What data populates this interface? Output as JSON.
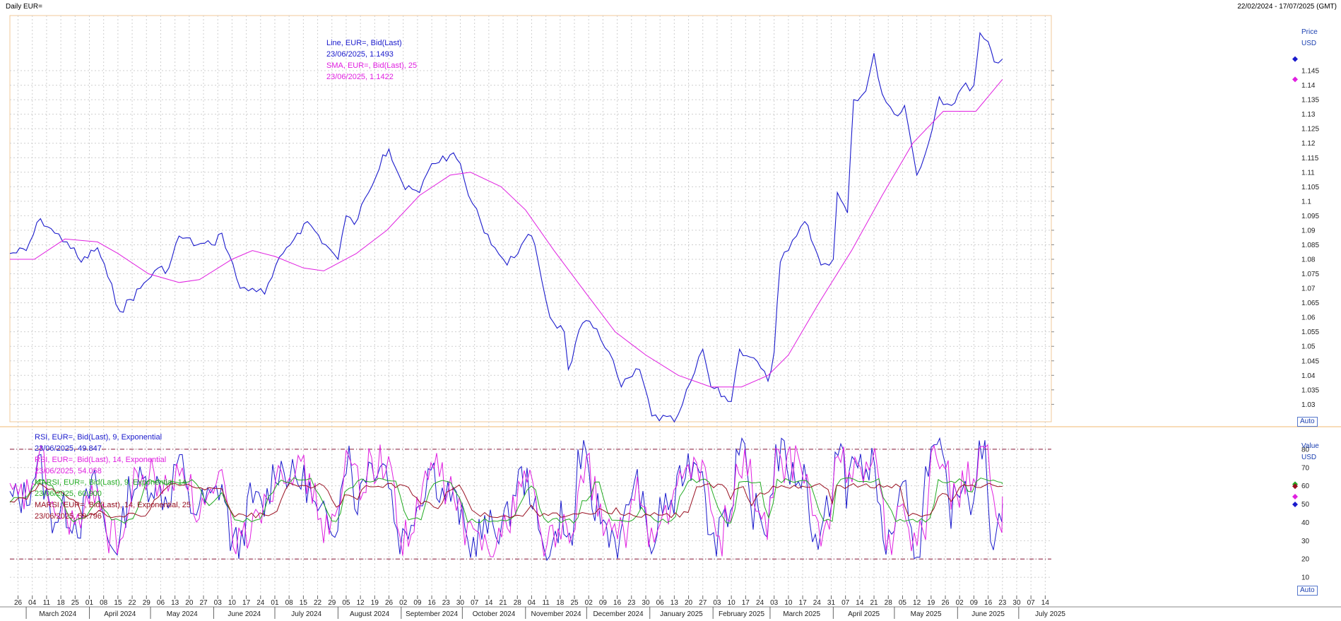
{
  "header": {
    "title": "Daily EUR=",
    "range": "22/02/2024 - 17/07/2025 (GMT)"
  },
  "price_panel": {
    "axis_title": "Price",
    "axis_unit": "USD",
    "auto_label": "Auto",
    "legend": [
      {
        "text": "Line, EUR=, Bid(Last)",
        "color": "#1a1acc"
      },
      {
        "text": "23/06/2025, 1.1493",
        "color": "#1a1acc"
      },
      {
        "text": "SMA, EUR=, Bid(Last),  25",
        "color": "#e020e0"
      },
      {
        "text": "23/06/2025, 1.1422",
        "color": "#e020e0"
      }
    ]
  },
  "rsi_panel": {
    "axis_title": "Value",
    "axis_unit": "USD",
    "auto_label": "Auto",
    "legend": [
      {
        "text": "RSI, EUR=, Bid(Last),  9, Exponential",
        "color": "#1a1acc"
      },
      {
        "text": "23/06/2025, 49.847",
        "color": "#1a1acc"
      },
      {
        "text": "RSI, EUR=, Bid(Last),  14, Exponential",
        "color": "#e020e0"
      },
      {
        "text": "23/06/2025, 54.058",
        "color": "#e020e0"
      },
      {
        "text": "MARSI, EUR=, Bid(Last),  9, Exponential, 14",
        "color": "#22aa22"
      },
      {
        "text": "23/06/2025, 60.900",
        "color": "#22aa22"
      },
      {
        "text": "MARSI, EUR=, Bid(Last),  14, Exponential, 25",
        "color": "#991122"
      },
      {
        "text": "23/06/2025, 59.796",
        "color": "#991122"
      }
    ]
  },
  "x_axis": {
    "day_ticks": [
      "26",
      "04",
      "11",
      "18",
      "25",
      "01",
      "08",
      "15",
      "22",
      "29",
      "06",
      "13",
      "20",
      "27",
      "03",
      "10",
      "17",
      "24",
      "01",
      "08",
      "15",
      "22",
      "29",
      "05",
      "12",
      "19",
      "26",
      "02",
      "09",
      "16",
      "23",
      "30",
      "07",
      "14",
      "21",
      "28",
      "04",
      "11",
      "18",
      "25",
      "02",
      "09",
      "16",
      "23",
      "30",
      "06",
      "13",
      "20",
      "27",
      "03",
      "10",
      "17",
      "24",
      "03",
      "10",
      "17",
      "24",
      "31",
      "07",
      "14",
      "21",
      "28",
      "05",
      "12",
      "19",
      "26",
      "02",
      "09",
      "16",
      "23",
      "30",
      "07",
      "14"
    ],
    "months": [
      "March 2024",
      "April 2024",
      "May 2024",
      "June 2024",
      "July 2024",
      "August 2024",
      "September 2024",
      "October 2024",
      "November 2024",
      "December 2024",
      "January 2025",
      "February 2025",
      "March 2025",
      "April 2025",
      "May 2025",
      "June 2025",
      "July 2025"
    ]
  },
  "chart_data": [
    {
      "type": "line",
      "title": "Daily EUR=",
      "ylabel": "Price USD",
      "ylim": [
        1.024,
        1.164
      ],
      "yticks": [
        "1.03",
        "1.035",
        "1.04",
        "1.045",
        "1.05",
        "1.055",
        "1.06",
        "1.065",
        "1.07",
        "1.075",
        "1.08",
        "1.085",
        "1.09",
        "1.095",
        "1.1",
        "1.105",
        "1.11",
        "1.115",
        "1.12",
        "1.125",
        "1.13",
        "1.135",
        "1.14",
        "1.145"
      ],
      "x_start": "2024-02-22",
      "x_end": "2025-07-17",
      "series": [
        {
          "name": "Line, EUR=, Bid(Last)",
          "color": "#1a1acc",
          "points": [
            [
              "2024-02-22",
              1.082
            ],
            [
              "2024-03-01",
              1.083
            ],
            [
              "2024-03-08",
              1.094
            ],
            [
              "2024-03-15",
              1.089
            ],
            [
              "2024-03-21",
              1.086
            ],
            [
              "2024-03-28",
              1.079
            ],
            [
              "2024-04-05",
              1.084
            ],
            [
              "2024-04-10",
              1.074
            ],
            [
              "2024-04-16",
              1.062
            ],
            [
              "2024-04-26",
              1.07
            ],
            [
              "2024-05-03",
              1.076
            ],
            [
              "2024-05-10",
              1.077
            ],
            [
              "2024-05-15",
              1.088
            ],
            [
              "2024-05-24",
              1.085
            ],
            [
              "2024-05-31",
              1.085
            ],
            [
              "2024-06-05",
              1.089
            ],
            [
              "2024-06-14",
              1.07
            ],
            [
              "2024-06-20",
              1.07
            ],
            [
              "2024-06-26",
              1.068
            ],
            [
              "2024-07-05",
              1.082
            ],
            [
              "2024-07-12",
              1.089
            ],
            [
              "2024-07-17",
              1.093
            ],
            [
              "2024-07-26",
              1.085
            ],
            [
              "2024-08-01",
              1.08
            ],
            [
              "2024-08-05",
              1.095
            ],
            [
              "2024-08-09",
              1.092
            ],
            [
              "2024-08-16",
              1.103
            ],
            [
              "2024-08-23",
              1.116
            ],
            [
              "2024-08-26",
              1.118
            ],
            [
              "2024-09-03",
              1.104
            ],
            [
              "2024-09-10",
              1.103
            ],
            [
              "2024-09-16",
              1.113
            ],
            [
              "2024-09-25",
              1.116
            ],
            [
              "2024-09-30",
              1.113
            ],
            [
              "2024-10-04",
              1.102
            ],
            [
              "2024-10-10",
              1.093
            ],
            [
              "2024-10-17",
              1.084
            ],
            [
              "2024-10-23",
              1.078
            ],
            [
              "2024-10-30",
              1.085
            ],
            [
              "2024-11-04",
              1.088
            ],
            [
              "2024-11-07",
              1.08
            ],
            [
              "2024-11-13",
              1.06
            ],
            [
              "2024-11-20",
              1.055
            ],
            [
              "2024-11-22",
              1.042
            ],
            [
              "2024-11-29",
              1.058
            ],
            [
              "2024-12-06",
              1.056
            ],
            [
              "2024-12-12",
              1.048
            ],
            [
              "2024-12-18",
              1.036
            ],
            [
              "2024-12-27",
              1.042
            ],
            [
              "2025-01-02",
              1.026
            ],
            [
              "2025-01-13",
              1.024
            ],
            [
              "2025-01-17",
              1.03
            ],
            [
              "2025-01-23",
              1.041
            ],
            [
              "2025-01-27",
              1.049
            ],
            [
              "2025-01-31",
              1.036
            ],
            [
              "2025-02-10",
              1.031
            ],
            [
              "2025-02-14",
              1.049
            ],
            [
              "2025-02-21",
              1.046
            ],
            [
              "2025-02-28",
              1.038
            ],
            [
              "2025-03-03",
              1.048
            ],
            [
              "2025-03-06",
              1.079
            ],
            [
              "2025-03-10",
              1.083
            ],
            [
              "2025-03-14",
              1.088
            ],
            [
              "2025-03-18",
              1.093
            ],
            [
              "2025-03-26",
              1.078
            ],
            [
              "2025-04-01",
              1.08
            ],
            [
              "2025-04-03",
              1.103
            ],
            [
              "2025-04-08",
              1.096
            ],
            [
              "2025-04-11",
              1.135
            ],
            [
              "2025-04-17",
              1.138
            ],
            [
              "2025-04-21",
              1.151
            ],
            [
              "2025-04-25",
              1.137
            ],
            [
              "2025-05-01",
              1.13
            ],
            [
              "2025-05-06",
              1.133
            ],
            [
              "2025-05-12",
              1.109
            ],
            [
              "2025-05-16",
              1.116
            ],
            [
              "2025-05-23",
              1.136
            ],
            [
              "2025-05-29",
              1.133
            ],
            [
              "2025-06-03",
              1.139
            ],
            [
              "2025-06-09",
              1.14
            ],
            [
              "2025-06-12",
              1.158
            ],
            [
              "2025-06-16",
              1.155
            ],
            [
              "2025-06-19",
              1.148
            ],
            [
              "2025-06-23",
              1.149
            ]
          ]
        },
        {
          "name": "SMA, EUR=, Bid(Last),  25",
          "color": "#e020e0",
          "points": [
            [
              "2024-02-22",
              1.08
            ],
            [
              "2024-03-05",
              1.08
            ],
            [
              "2024-03-20",
              1.087
            ],
            [
              "2024-04-05",
              1.086
            ],
            [
              "2024-04-15",
              1.082
            ],
            [
              "2024-04-30",
              1.075
            ],
            [
              "2024-05-15",
              1.072
            ],
            [
              "2024-05-25",
              1.073
            ],
            [
              "2024-06-10",
              1.08
            ],
            [
              "2024-06-20",
              1.083
            ],
            [
              "2024-07-01",
              1.081
            ],
            [
              "2024-07-15",
              1.077
            ],
            [
              "2024-07-25",
              1.076
            ],
            [
              "2024-08-10",
              1.082
            ],
            [
              "2024-08-25",
              1.09
            ],
            [
              "2024-09-10",
              1.102
            ],
            [
              "2024-09-25",
              1.109
            ],
            [
              "2024-10-05",
              1.11
            ],
            [
              "2024-10-20",
              1.105
            ],
            [
              "2024-11-01",
              1.097
            ],
            [
              "2024-11-15",
              1.083
            ],
            [
              "2024-12-01",
              1.068
            ],
            [
              "2024-12-15",
              1.055
            ],
            [
              "2024-12-30",
              1.047
            ],
            [
              "2025-01-15",
              1.04
            ],
            [
              "2025-01-31",
              1.036
            ],
            [
              "2025-02-15",
              1.036
            ],
            [
              "2025-02-28",
              1.04
            ],
            [
              "2025-03-10",
              1.047
            ],
            [
              "2025-03-25",
              1.065
            ],
            [
              "2025-04-10",
              1.083
            ],
            [
              "2025-04-25",
              1.102
            ],
            [
              "2025-05-10",
              1.12
            ],
            [
              "2025-05-25",
              1.131
            ],
            [
              "2025-06-10",
              1.131
            ],
            [
              "2025-06-23",
              1.142
            ]
          ]
        }
      ]
    },
    {
      "type": "line",
      "ylabel": "Value USD",
      "ylim": [
        0,
        90
      ],
      "yticks": [
        10,
        20,
        30,
        40,
        50,
        60,
        70,
        80
      ],
      "reference_lines": [
        20,
        80
      ],
      "series": [
        {
          "name": "RSI, EUR=, Bid(Last),  9, Exponential",
          "color": "#1a1acc",
          "base": 52,
          "amp": 24,
          "last": 49.847
        },
        {
          "name": "RSI, EUR=, Bid(Last),  14, Exponential",
          "color": "#e020e0",
          "base": 52,
          "amp": 20,
          "last": 54.058
        },
        {
          "name": "MARSI, EUR=, Bid(Last),  9, Exponential, 14",
          "color": "#22aa22",
          "base": 52,
          "amp": 11,
          "last": 60.9
        },
        {
          "name": "MARSI, EUR=, Bid(Last),  14, Exponential, 25",
          "color": "#991122",
          "base": 52,
          "amp": 8,
          "last": 59.796
        }
      ]
    }
  ]
}
